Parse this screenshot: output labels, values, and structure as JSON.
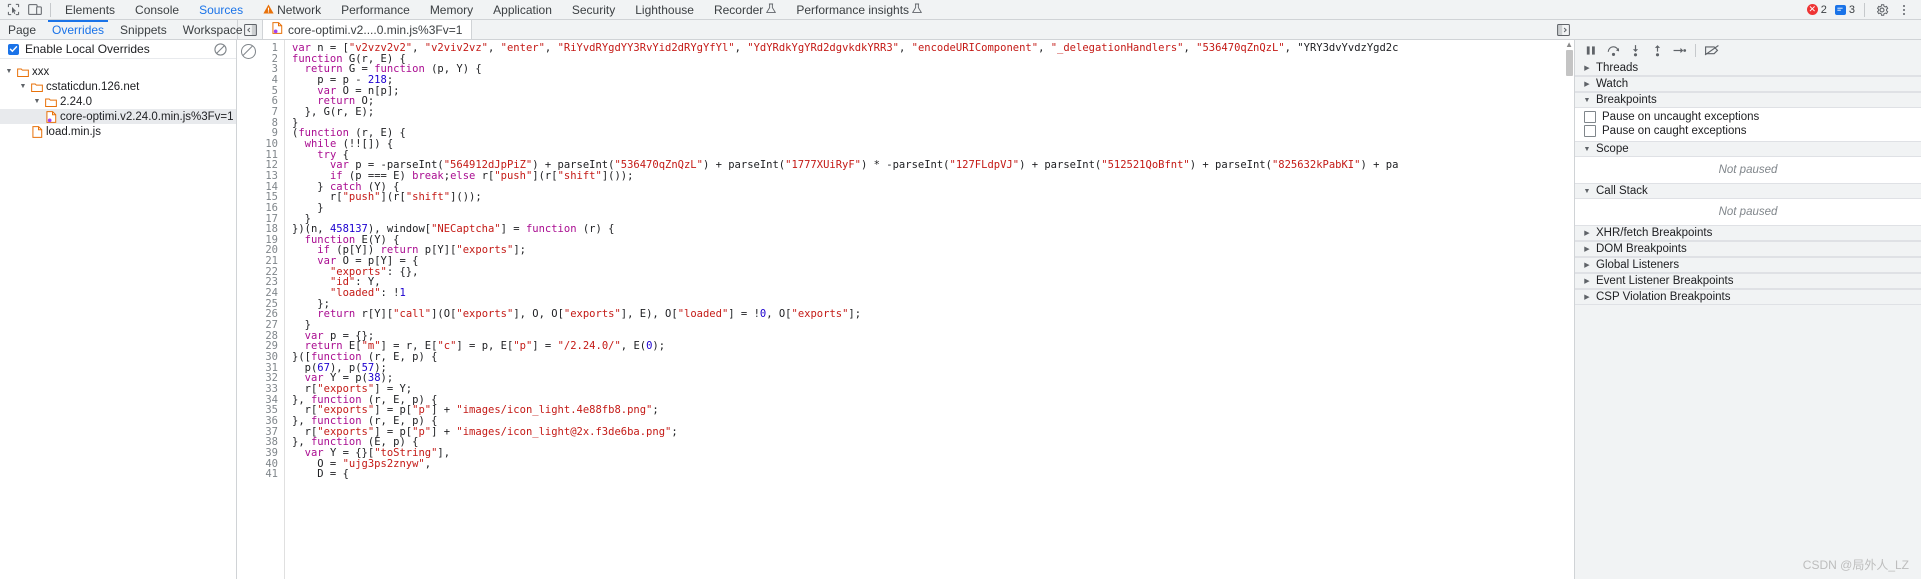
{
  "main_toolbar": {
    "inspect_icon": "inspect-element-icon",
    "device_icon": "device-toolbar-icon",
    "tabs": [
      {
        "label": "Elements",
        "active": false,
        "warn": false,
        "beaker": false
      },
      {
        "label": "Console",
        "active": false,
        "warn": false,
        "beaker": false
      },
      {
        "label": "Sources",
        "active": true,
        "warn": false,
        "beaker": false
      },
      {
        "label": "Network",
        "active": false,
        "warn": true,
        "beaker": false
      },
      {
        "label": "Performance",
        "active": false,
        "warn": false,
        "beaker": false
      },
      {
        "label": "Memory",
        "active": false,
        "warn": false,
        "beaker": false
      },
      {
        "label": "Application",
        "active": false,
        "warn": false,
        "beaker": false
      },
      {
        "label": "Security",
        "active": false,
        "warn": false,
        "beaker": false
      },
      {
        "label": "Lighthouse",
        "active": false,
        "warn": false,
        "beaker": false
      },
      {
        "label": "Recorder",
        "active": false,
        "warn": false,
        "beaker": true
      },
      {
        "label": "Performance insights",
        "active": false,
        "warn": false,
        "beaker": true
      }
    ],
    "error_count": "2",
    "message_count": "3",
    "settings_icon": "gear-icon",
    "more_icon": "kebab-menu-icon"
  },
  "sub_toolbar": {
    "nav_tabs": [
      {
        "label": "Page",
        "active": false
      },
      {
        "label": "Overrides",
        "active": true
      },
      {
        "label": "Snippets",
        "active": false
      },
      {
        "label": "Workspace",
        "active": false
      }
    ],
    "more_tabs_icon": "chevron-double-right-icon",
    "nav_more_icon": "kebab-menu-icon",
    "show_navigator_icon": "show-navigator-panel-icon",
    "file_tab": {
      "label": "core-optimi.v2....0.min.js%3Fv=1",
      "icon": "js-override-file-icon"
    }
  },
  "navigator": {
    "enable_overrides": {
      "label": "Enable Local Overrides",
      "checked": true
    },
    "clear_icon": "clear-overrides-icon",
    "tree": [
      {
        "label": "xxx",
        "depth": 0,
        "type": "folder",
        "expanded": true,
        "selected": false
      },
      {
        "label": "cstaticdun.126.net",
        "depth": 1,
        "type": "folder",
        "expanded": true,
        "selected": false
      },
      {
        "label": "2.24.0",
        "depth": 2,
        "type": "folder",
        "expanded": true,
        "selected": false
      },
      {
        "label": "core-optimi.v2.24.0.min.js%3Fv=1",
        "depth": 3,
        "type": "file",
        "expanded": false,
        "selected": true
      },
      {
        "label": "load.min.js",
        "depth": 2,
        "type": "file",
        "expanded": false,
        "selected": false
      }
    ]
  },
  "editor": {
    "readonly_icon": "no-edit-icon",
    "first_line": 1,
    "last_line": 41,
    "code_lines": [
      "var n = [\"v2vzv2v2\", \"v2viv2vz\", \"enter\", \"RiYvdRYgdYY3RvYid2dRYgYfYl\", \"YdYRdkYgYRd2dgvkdkYRR3\", \"encodeURIComponent\", \"_delegationHandlers\", \"536470qZnQzL\", \"YRY3dvYvdzYgd2c",
      "function G(r, E) {",
      "  return G = function (p, Y) {",
      "    p = p - 218;",
      "    var O = n[p];",
      "    return O;",
      "  }, G(r, E);",
      "}",
      "(function (r, E) {",
      "  while (!![]) {",
      "    try {",
      "      var p = -parseInt(\"564912dJpPiZ\") + parseInt(\"536470qZnQzL\") + parseInt(\"1777XUiRyF\") * -parseInt(\"127FLdpVJ\") + parseInt(\"512521QoBfnt\") + parseInt(\"825632kPabKI\") + pa",
      "      if (p === E) break;else r[\"push\"](r[\"shift\"]());",
      "    } catch (Y) {",
      "      r[\"push\"](r[\"shift\"]());",
      "    }",
      "  }",
      "})(n, 458137), window[\"NECaptcha\"] = function (r) {",
      "  function E(Y) {",
      "    if (p[Y]) return p[Y][\"exports\"];",
      "    var O = p[Y] = {",
      "      \"exports\": {},",
      "      \"id\": Y,",
      "      \"loaded\": !1",
      "    };",
      "    return r[Y][\"call\"](O[\"exports\"], O, O[\"exports\"], E), O[\"loaded\"] = !0, O[\"exports\"];",
      "  }",
      "  var p = {};",
      "  return E[\"m\"] = r, E[\"c\"] = p, E[\"p\"] = \"/2.24.0/\", E(0);",
      "}([function (r, E, p) {",
      "  p(67), p(57);",
      "  var Y = p(38);",
      "  r[\"exports\"] = Y;",
      "}, function (r, E, p) {",
      "  r[\"exports\"] = p[\"p\"] + \"images/icon_light.4e88fb8.png\";",
      "}, function (r, E, p) {",
      "  r[\"exports\"] = p[\"p\"] + \"images/icon_light@2x.f3de6ba.png\";",
      "}, function (E, p) {",
      "  var Y = {}[\"toString\"],",
      "    O = \"ujg3ps2znyw\",",
      "    D = {"
    ]
  },
  "debugger": {
    "controls": [
      {
        "name": "pause-resume-script-icon",
        "label": "Pause script execution"
      },
      {
        "name": "step-over-icon",
        "label": "Step over next function call"
      },
      {
        "name": "step-into-icon",
        "label": "Step into next function call"
      },
      {
        "name": "step-out-icon",
        "label": "Step out of current function"
      },
      {
        "name": "step-icon",
        "label": "Step"
      },
      {
        "name": "deactivate-breakpoints-icon",
        "label": "Deactivate breakpoints"
      }
    ],
    "sections": [
      {
        "title": "Threads",
        "expanded": false
      },
      {
        "title": "Watch",
        "expanded": false
      },
      {
        "title": "Breakpoints",
        "expanded": true
      },
      {
        "title": "Scope",
        "expanded": true,
        "empty_text": "Not paused"
      },
      {
        "title": "Call Stack",
        "expanded": true,
        "empty_text": "Not paused"
      },
      {
        "title": "XHR/fetch Breakpoints",
        "expanded": false
      },
      {
        "title": "DOM Breakpoints",
        "expanded": false
      },
      {
        "title": "Global Listeners",
        "expanded": false
      },
      {
        "title": "Event Listener Breakpoints",
        "expanded": false
      },
      {
        "title": "CSP Violation Breakpoints",
        "expanded": false
      }
    ],
    "breakpoint_options": [
      {
        "label": "Pause on uncaught exceptions",
        "checked": false
      },
      {
        "label": "Pause on caught exceptions",
        "checked": false
      }
    ]
  },
  "watermark": {
    "text": "CSDN @局外人_LZ"
  },
  "colors": {
    "accent": "#1a73e8",
    "toolbar_bg": "#f1f3f4",
    "error": "#ee3434",
    "warning": "#e8710a",
    "string": "#c41a16",
    "keyword": "#aa0d91",
    "number": "#1c00cf"
  }
}
